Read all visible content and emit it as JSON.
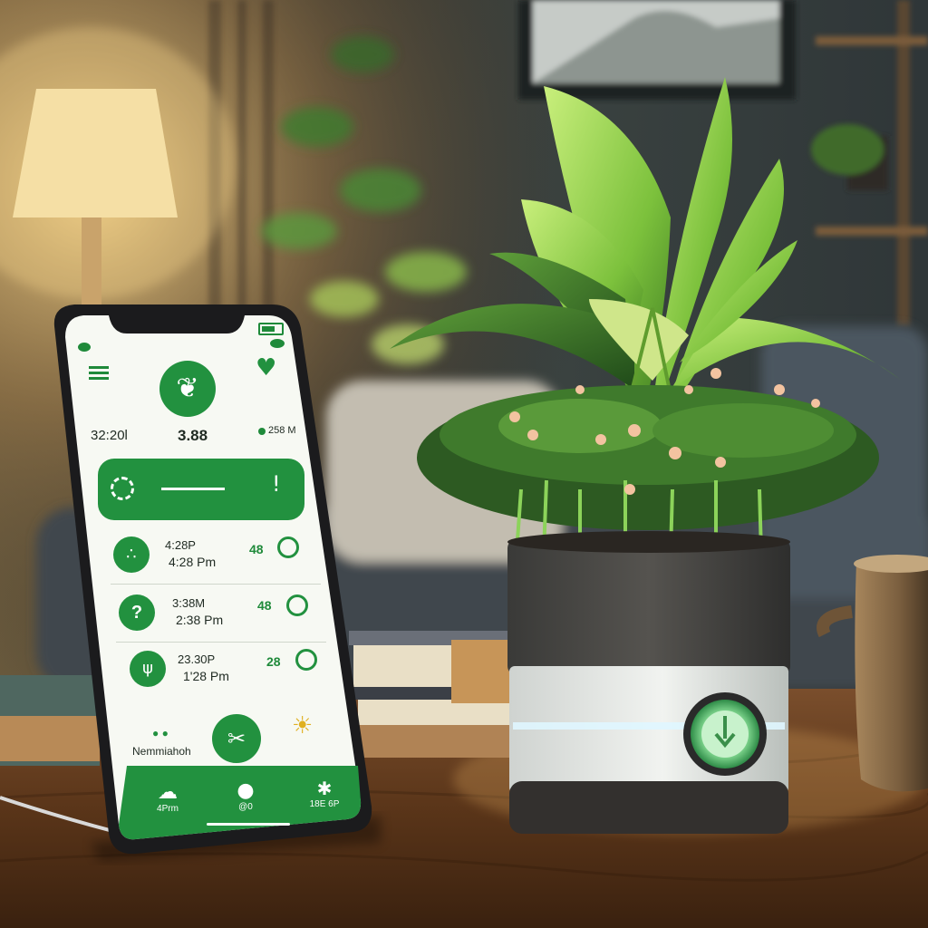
{
  "phone": {
    "status_right": "",
    "header": {
      "left_time": "32:20l",
      "center_value": "3.88",
      "right_value": "258 M"
    },
    "banner": {
      "label": ""
    },
    "schedule": [
      {
        "line1": "4:28P",
        "line2": "4:28 Pm",
        "value": "48"
      },
      {
        "line1": "3:38M",
        "line2": "2:38 Pm",
        "value": "48"
      },
      {
        "line1": "23.30P",
        "line2": "1'28 Pm",
        "value": "28"
      }
    ],
    "bottom_row": {
      "left_label": "Nemmiahoh",
      "right_label": ""
    },
    "nav": [
      {
        "label": "4Prm"
      },
      {
        "label": "@0"
      },
      {
        "label": "18E 6P"
      }
    ]
  },
  "colors": {
    "accent_green": "#22913f",
    "screen_bg": "#f7f9f3",
    "phone_frame": "#1b1b1d"
  },
  "icons": [
    "menu-icon",
    "sprout-icon",
    "heart-leaf-icon",
    "droplet-icon",
    "moisture-icon",
    "help-icon",
    "fern-icon",
    "target-icon",
    "sun-icon",
    "cloud-icon",
    "bulb-icon"
  ]
}
